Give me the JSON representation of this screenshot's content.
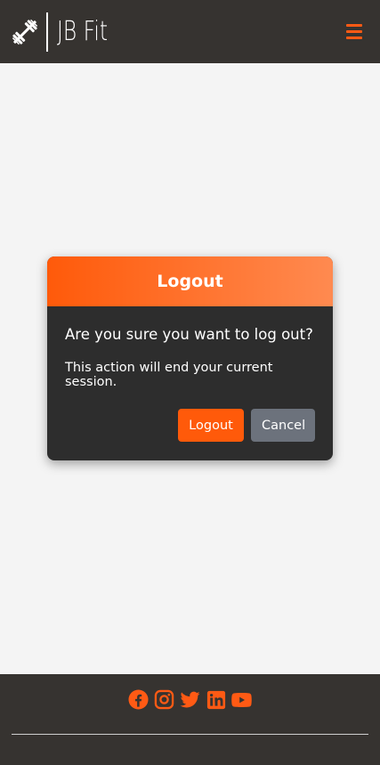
{
  "header": {
    "brand_text": "JB Fit",
    "logo_icon": "barbell-icon",
    "menu_icon": "hamburger-menu-icon",
    "accent_color": "#ff5a14",
    "background_color": "#363330"
  },
  "modal": {
    "title": "Logout",
    "question": "Are you sure you want to log out?",
    "note": "This action will end your current session.",
    "confirm_label": "Logout",
    "cancel_label": "Cancel",
    "header_gradient": [
      "#ff5a0a",
      "#ff8a50"
    ],
    "body_color": "#2d2d2d",
    "cancel_color": "#6c727c"
  },
  "footer": {
    "social_icons": [
      "facebook-icon",
      "instagram-icon",
      "twitter-icon",
      "linkedin-icon",
      "youtube-icon"
    ],
    "icon_color": "#ff5a14"
  }
}
